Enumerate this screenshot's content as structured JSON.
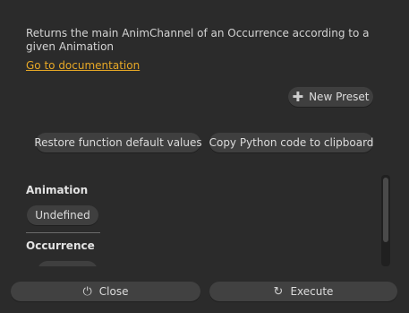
{
  "description": "Returns the main AnimChannel of an Occurrence according to a given Animation",
  "doc_link": "Go to documentation",
  "toolbar": {
    "new_preset_label": "New Preset",
    "restore_label": "Restore function default values",
    "copy_label": "Copy Python code to clipboard"
  },
  "params": {
    "animation_label": "Animation",
    "animation_value": "Undefined",
    "occurrence_label": "Occurrence"
  },
  "footer": {
    "close_label": "Close",
    "execute_label": "Execute"
  },
  "icons": {
    "new_preset": "plus-icon",
    "close": "power-icon",
    "execute": "refresh-icon"
  },
  "colors": {
    "background": "#2b2b2b",
    "link": "#e7a826",
    "button": "#3f3f3f"
  }
}
